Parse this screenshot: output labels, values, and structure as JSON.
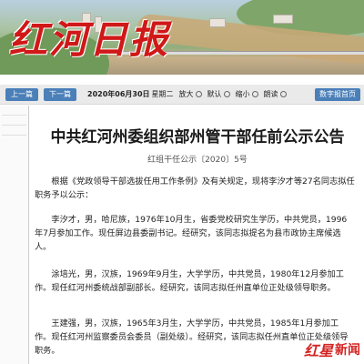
{
  "banner": {
    "brand": "红河日报"
  },
  "toolbar": {
    "prev_label": "上一篇",
    "next_label": "下一篇",
    "date": "2020年06月30日",
    "weekday": "星期二",
    "zoom_in": "放大",
    "zoom_default": "默认",
    "zoom_out": "缩小",
    "listen": "朗读",
    "home": "数字报首页"
  },
  "article": {
    "title": "中共红河州委组织部州管干部任前公示公告",
    "doc_number": "红组干任公示〔2020〕5号",
    "paragraphs": [
      "根据《党政领导干部选拔任用工作条例》及有关规定，现将李汐才等27名同志拟任职务予以公示：",
      "李汐才，男，哈尼族，1976年10月生，省委党校研究生学历，中共党员，1996年7月参加工作。现任屏边县委副书记。经研究，该同志拟提名为县市政协主席候选人。",
      "涂培光，男，汉族，1969年9月生，大学学历，中共党员，1980年12月参加工作。现任红河州委统战部副部长。经研究，该同志拟任州直单位正处级领导职务。",
      "王建强，男，汉族，1965年3月生，大学学历，中共党员，1985年1月参加工作。现任红河州监察委员会委员（副处级）。经研究，该同志拟任州直单位正处级领导职务。"
    ]
  },
  "watermark": {
    "logo": "红星",
    "text": "新闻"
  }
}
